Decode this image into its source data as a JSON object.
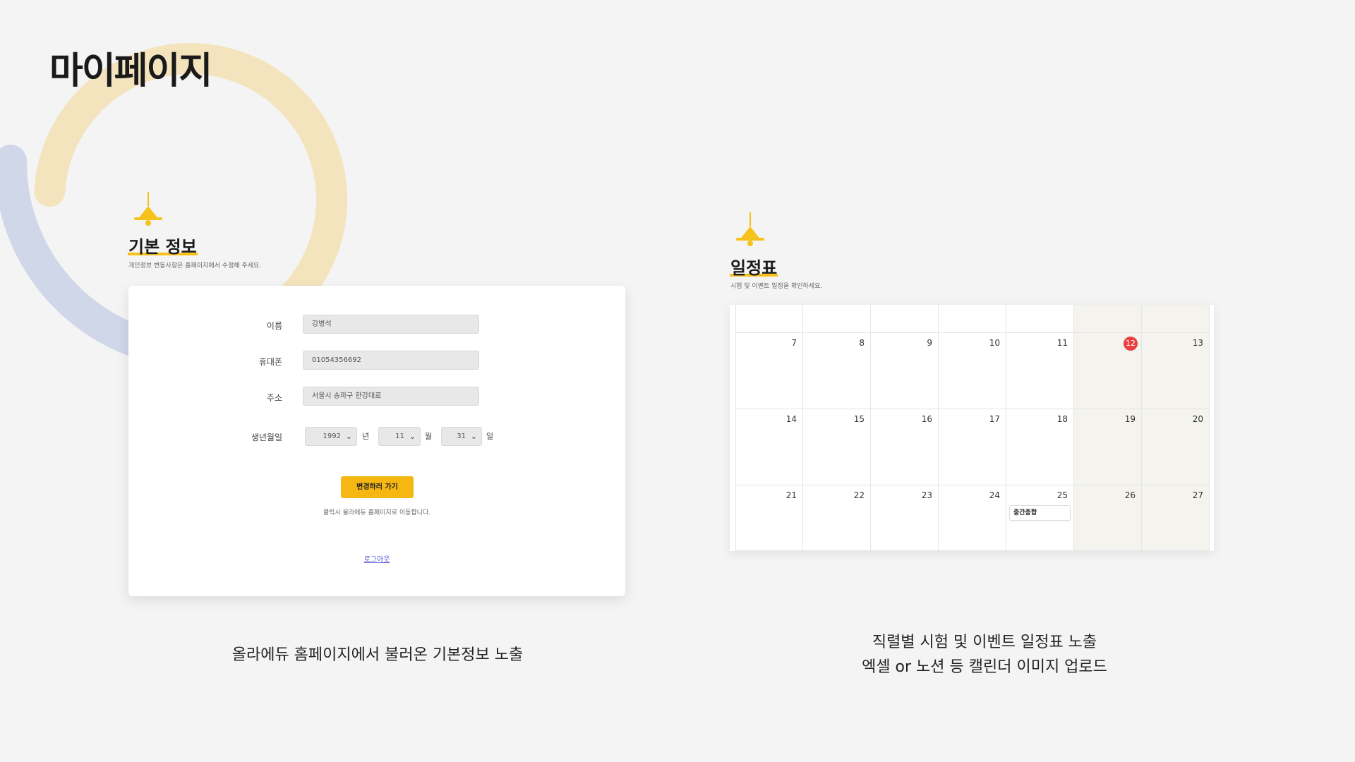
{
  "page": {
    "title": "마이페이지"
  },
  "basic_info": {
    "title": "기본 정보",
    "subtitle": "개인정보 변동사항은 홈페이지에서 수정해 주세요.",
    "fields": [
      {
        "label": "이름",
        "value": "강병석"
      },
      {
        "label": "휴대폰",
        "value": "01054356692"
      },
      {
        "label": "주소",
        "value": "서울시 송파구 한강대로"
      }
    ],
    "birth": {
      "label": "생년월일",
      "year": "1992",
      "year_unit": "년",
      "month": "11",
      "month_unit": "월",
      "day": "31",
      "day_unit": "일"
    },
    "change_button": "변경하러 가기",
    "hint": "클릭시 올라에듀 홈페이지로 이동합니다.",
    "logout": "로그아웃"
  },
  "schedule": {
    "title": "일정표",
    "subtitle": "시험 및 이벤트 일정을 확인하세요.",
    "weeks": [
      [
        "",
        "",
        "",
        "",
        "",
        "",
        ""
      ],
      [
        "7",
        "8",
        "9",
        "10",
        "11",
        "12",
        "13"
      ],
      [
        "14",
        "15",
        "16",
        "17",
        "18",
        "19",
        "20"
      ],
      [
        "21",
        "22",
        "23",
        "24",
        "25",
        "26",
        "27"
      ]
    ],
    "today": "12",
    "today_color": "#e84040",
    "events": [
      {
        "day": "25",
        "label": "중간종합"
      }
    ]
  },
  "captions": {
    "left": "올라에듀 홈페이지에서 불러온 기본정보 노출",
    "right_line1": "직렬별 시험 및 이벤트 일정표 노출",
    "right_line2": "엑셀 or 노션 등 캘린더 이미지 업로드"
  },
  "colors": {
    "accent": "#f6b712",
    "logout_link": "#5a5fd6"
  }
}
